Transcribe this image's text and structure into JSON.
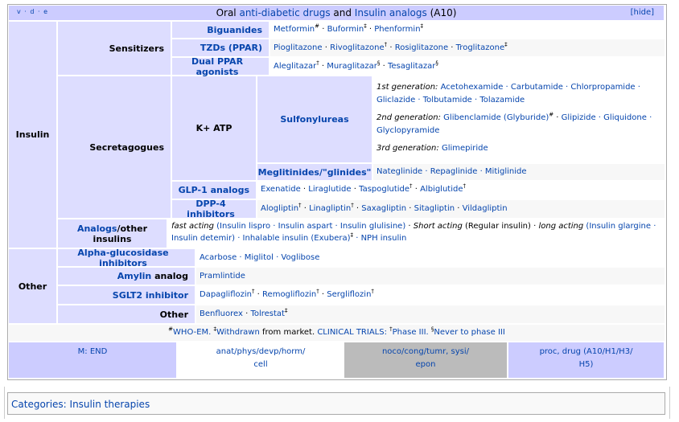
{
  "title": {
    "pre": "Oral ",
    "link1": "anti-diabetic drugs",
    "mid": " and ",
    "link2": "Insulin analogs",
    "post": " (A10)"
  },
  "vde": "v · d · e",
  "hide": "[hide]",
  "insulin_label": "Insulin",
  "other_label": "Other",
  "sensitizers": "Sensitizers",
  "secretagogues": "Secretagogues",
  "biguanides": "Biguanides",
  "biguanides_list": [
    "Metformin",
    "Buformin",
    "Phenformin"
  ],
  "tzds": "TZDs (PPAR)",
  "tzds_list": [
    "Pioglitazone",
    "Rivoglitazone",
    "Rosiglitazone",
    "Troglitazone"
  ],
  "dual": "Dual PPAR agonists",
  "dual_list": [
    "Aleglitazar",
    "Muraglitazar",
    "Tesaglitazar"
  ],
  "katp": "K+ ATP",
  "sulfonylureas": "Sulfonylureas",
  "su_1st_label": "1st generation:",
  "su_1st": "Acetohexamide · Carbutamide · Chlorpropamide · Gliclazide · Tolbutamide · Tolazamide",
  "su_2nd_label": "2nd generation:",
  "su_2nd_a": "Glibenclamide (Glyburide)",
  "su_2nd_b": "Glipizide · Gliquidone · Glyclopyramide",
  "su_3rd_label": "3rd generation:",
  "su_3rd": "Glimepiride",
  "meglitinides": "Meglitinides/\"glinides\"",
  "meglitinides_list": "Nateglinide · Repaglinide · Mitiglinide",
  "glp1": "GLP-1 analogs",
  "glp1_list": [
    "Exenatide",
    "Liraglutide",
    "Taspoglutide",
    "Albiglutide"
  ],
  "dpp4": "DPP-4 inhibitors",
  "dpp4_list": [
    "Alogliptin",
    "Linagliptin",
    "Saxagliptin",
    "Sitagliptin",
    "Vildagliptin"
  ],
  "analogs_link": "Analogs",
  "analogs_rest": "/other insulins",
  "analogs_line1": {
    "fast": "fast acting",
    "fast_list": "(Insulin lispro · Insulin aspart · Insulin glulisine)",
    "short": "Short acting",
    "regular": "(Regular insulin)",
    "long": "long acting",
    "long_a": "(Insulin glargine ·"
  },
  "analogs_line2": {
    "a": "Insulin detemir) · Inhalable insulin (Exubera)",
    "b": "· NPH insulin"
  },
  "alpha": "Alpha-glucosidase inhibitors",
  "alpha_list": "Acarbose · Miglitol · Voglibose",
  "amylin_link": "Amylin",
  "amylin_rest": " analog",
  "amylin_list": "Pramlintide",
  "sglt2": "SGLT2 inhibitor",
  "sglt2_list": [
    "Dapagliflozin",
    "Remogliflozin",
    "Sergliflozin"
  ],
  "other_row": "Other",
  "other_list": [
    "Benfluorex",
    "Tolrestat"
  ],
  "footnote": {
    "a": "WHO-EM.",
    "b": "Withdrawn",
    "c": " from market. ",
    "d": "CLINICAL TRIALS:",
    "e": "Phase III.",
    "f": "Never to phase III"
  },
  "meta": {
    "m": "M: END",
    "c1a": "anat/phys/devp/horm/",
    "c1b": "cell",
    "c2a": "noco/cong/tumr, sysi/",
    "c2b": "epon",
    "c3a": "proc, drug (A10/H1/H3/",
    "c3b": "H5)"
  },
  "categories": "Categories: Insulin therapies",
  "colors": {
    "group": "#ddf",
    "title": "#ccf",
    "link": "#0645ad",
    "grey": "#bbb"
  }
}
